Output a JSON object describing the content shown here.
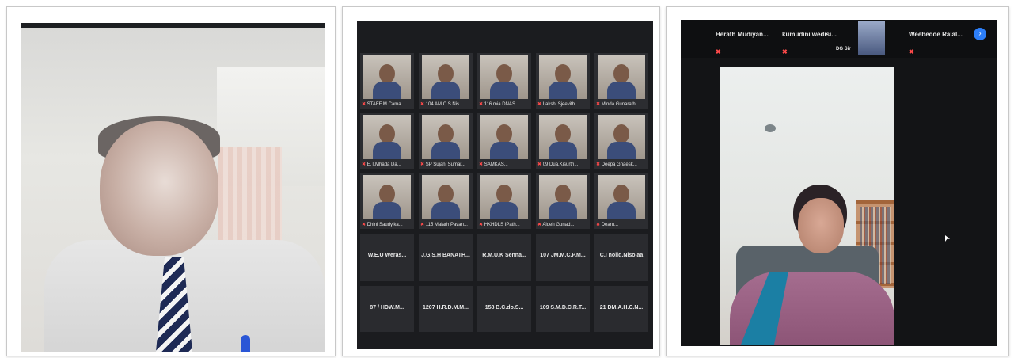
{
  "panel_gallery": {
    "tiles": [
      {
        "name": "STAFF M.Cama..."
      },
      {
        "name": "104 AM.C.S.Nis..."
      },
      {
        "name": "116 mia DNAS..."
      },
      {
        "name": "Lakshi Sjeevith..."
      },
      {
        "name": "Minda Gunarath..."
      },
      {
        "name": "E.T.Mhada Da..."
      },
      {
        "name": "SP Sujani Sumar..."
      },
      {
        "name": "SAMKAS..."
      },
      {
        "name": "09 Dua.Kisurth..."
      },
      {
        "name": "Deepa Gnaesk..."
      },
      {
        "name": "Dhini Saudyika..."
      },
      {
        "name": "115 Malarh Pavan..."
      },
      {
        "name": "HKHDLS IPath..."
      },
      {
        "name": "Aldeh Gunad..."
      },
      {
        "name": "Dearu..."
      }
    ],
    "name_only": [
      {
        "name": "W.E.U Weras..."
      },
      {
        "name": "J.G.S.H BANATH..."
      },
      {
        "name": "R.M.U.K Senna..."
      },
      {
        "name": "107 JM.M.C.P.M..."
      },
      {
        "name": "C.I noliq.Nisolaa"
      },
      {
        "name": "87 / HDW.M..."
      },
      {
        "name": "1207 H.R.D.M.M..."
      },
      {
        "name": "158 B.C.do.S..."
      },
      {
        "name": "109 S.M.D.C.R.T..."
      },
      {
        "name": "21 DM.A.H.C.N..."
      }
    ]
  },
  "panel_speaker": {
    "top_names": [
      "Herath Mudiyan...",
      "kumudini wedisi...",
      "DG Sir",
      "Weebedde Ralal..."
    ],
    "next_page_symbol": "›"
  }
}
